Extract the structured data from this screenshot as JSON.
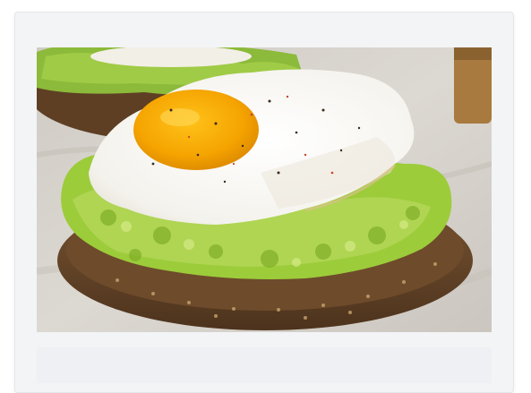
{
  "photo": {
    "subject_icon": "fried-egg-avocado-toast-photo",
    "colors": {
      "cloth": "#d9d5cf",
      "bread": "#6b4a2c",
      "avocado": "#9ccc3a",
      "egg_white": "#f7f6f1",
      "yolk": "#f5a400"
    }
  }
}
